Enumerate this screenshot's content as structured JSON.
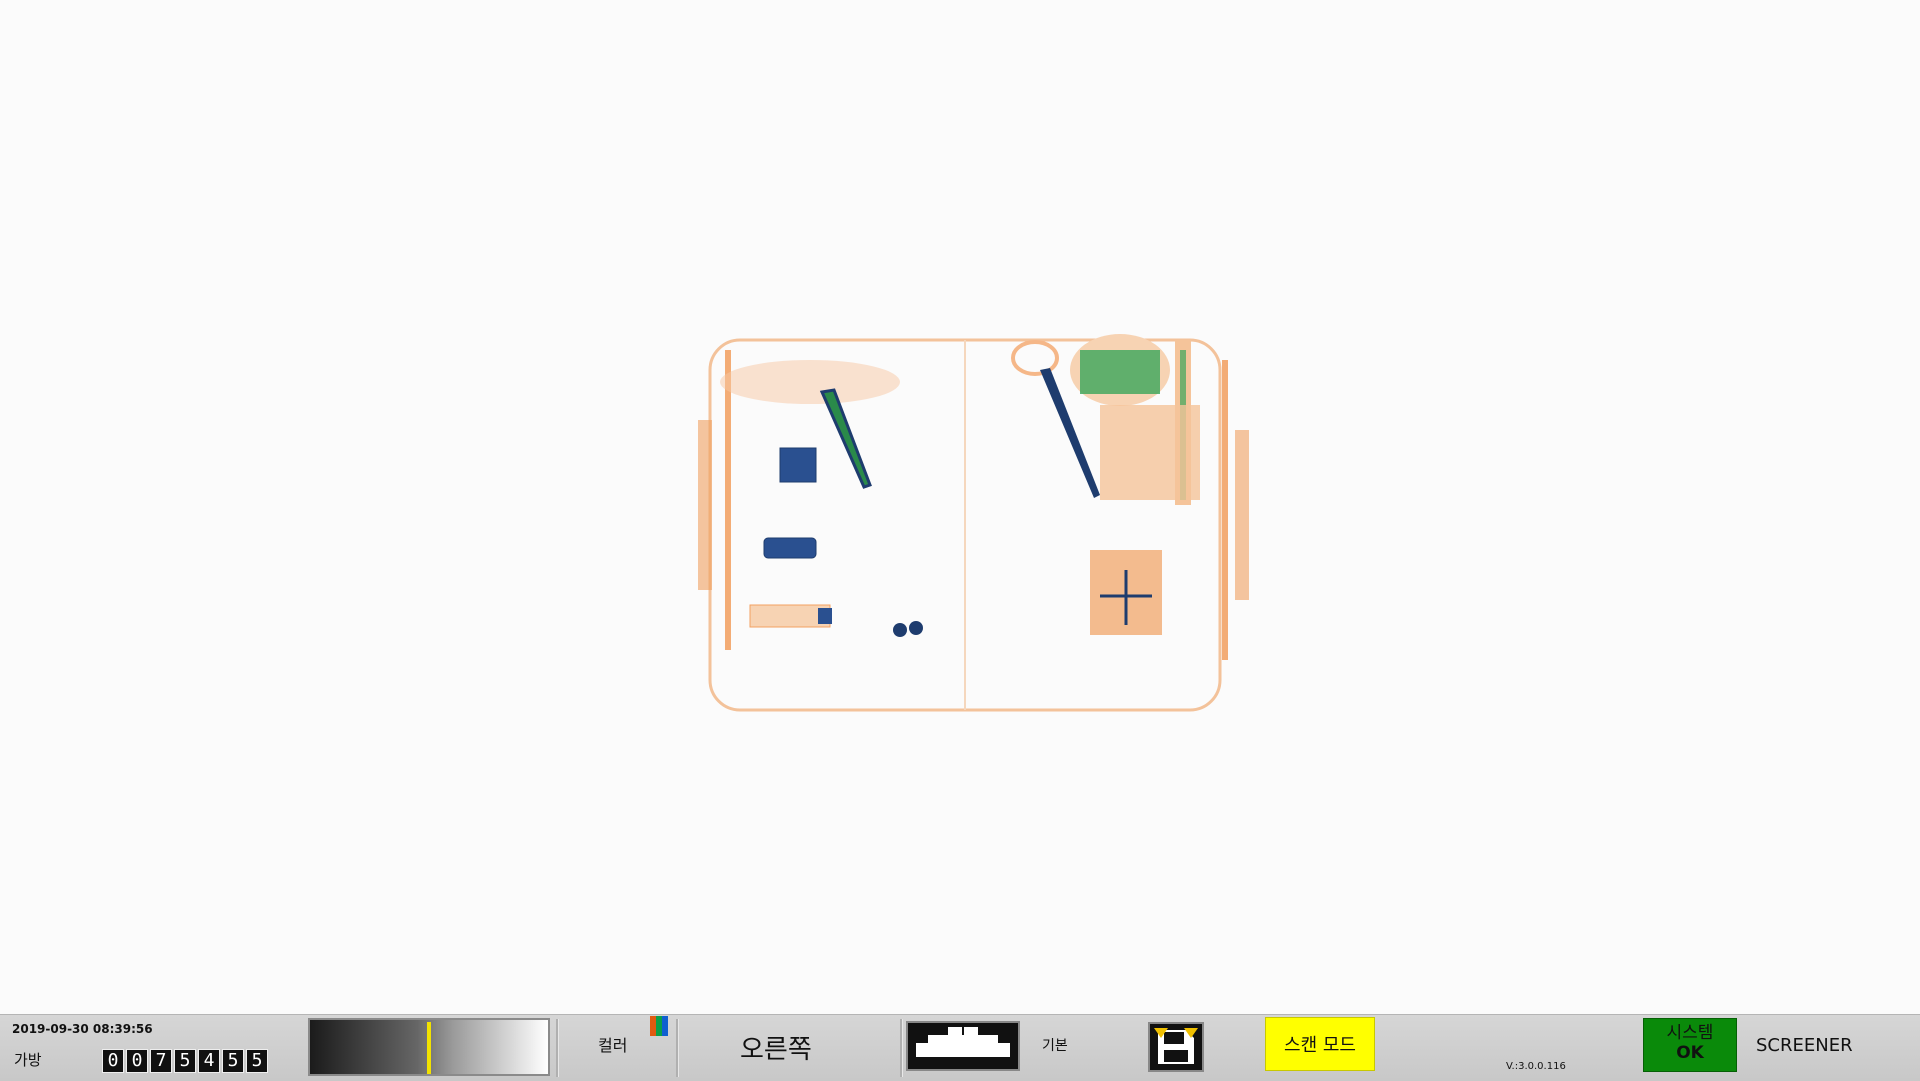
{
  "status_bar": {
    "datetime": "2019-09-30 08:39:56",
    "bag_label": "가방",
    "bag_counter": [
      "0",
      "0",
      "7",
      "5",
      "4",
      "5",
      "5"
    ],
    "gradient_level": 0.5,
    "color_label": "컬러",
    "color_swatch": [
      "#e05a10",
      "#0aa04a",
      "#1060d0"
    ],
    "side_label": "오른쪽",
    "mode_label": "기본",
    "scan_mode_label": "스캔 모드",
    "version": "V.:3.0.0.116",
    "system_label": "시스템",
    "system_status": "OK",
    "role_label": "SCREENER"
  },
  "colors": {
    "organic": "#f08a3c",
    "inorganic": "#3aa65a",
    "metal": "#1e3c6e",
    "scan_mode_bg": "#ffff00",
    "system_ok_bg": "#0a8a0a"
  },
  "icons": {
    "scanner": "xray-scanner-icon",
    "save": "floppy-disk-icon"
  }
}
